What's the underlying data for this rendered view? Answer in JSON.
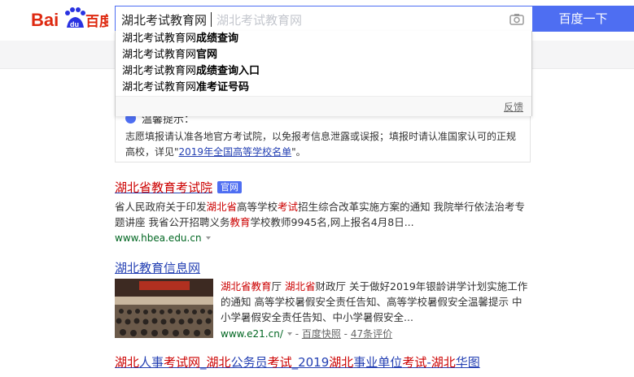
{
  "header": {
    "logo_text_1": "Bai",
    "logo_text_2": "du",
    "logo_text_3": "百度",
    "search_value": "湖北考试教育网",
    "search_ghost": "湖北考试教育网",
    "search_button": "百度一下"
  },
  "suggestions": {
    "items": [
      {
        "prefix": "湖北考试教育网",
        "suffix": "成绩查询"
      },
      {
        "prefix": "湖北考试教育网",
        "suffix": "官网"
      },
      {
        "prefix": "湖北考试教育网",
        "suffix": "成绩查询入口"
      },
      {
        "prefix": "湖北考试教育网",
        "suffix": "准考证号码"
      }
    ],
    "feedback": "反馈"
  },
  "notice": {
    "title": "温馨提示：",
    "text_1": "志愿填报请认准各地官方考试院，以免报考信息泄露或误报；填报时请认准国家认可的正规高校，详见\"",
    "link": "2019年全国高等学校名单",
    "text_2": "\"。"
  },
  "results": [
    {
      "title_parts": [
        "湖北省教育考试院"
      ],
      "badge": "官网",
      "abstract_1": "省人民政府关于印发",
      "abstract_em_1": "湖北省",
      "abstract_2": "高等学校",
      "abstract_em_2": "考试",
      "abstract_3": "招生综合改革实施方案的通知 我院举行依法治考专题讲座 我省公开招聘义务",
      "abstract_em_3": "教育",
      "abstract_4": "学校教师9945名,网上报名4月8日...",
      "url": "www.hbea.edu.cn"
    },
    {
      "title": "湖北教育信息网",
      "abstract_em_1": "湖北省教育",
      "abstract_1": "厅 ",
      "abstract_em_2": "湖北省",
      "abstract_2": "财政厅 关于做好2019年银龄讲学计划实施工作的通知 高等学校暑假安全责任告知、高等学校暑假安全温馨提示 中小学暑假安全责任告知、中小学暑假安全...",
      "url": "www.e21.cn/",
      "snapshot": "百度快照",
      "reviews": "47条评价",
      "sep_1": " - ",
      "sep_2": " - "
    },
    {
      "title_em_1": "湖北",
      "title_1": "人事",
      "title_em_2": "考试网",
      "title_2": "_",
      "title_em_3": "湖北",
      "title_3": "公务员",
      "title_em_4": "考试",
      "title_4": "_2019",
      "title_em_5": "湖北",
      "title_5": "事业单位",
      "title_em_6": "考试",
      "title_6": "-",
      "title_em_7": "湖北",
      "title_7": "华图"
    }
  ],
  "colors": {
    "accent": "#4e6ef2",
    "title": "#2440b3",
    "highlight": "#c00",
    "url": "#006621",
    "logo_red": "#de2910"
  }
}
